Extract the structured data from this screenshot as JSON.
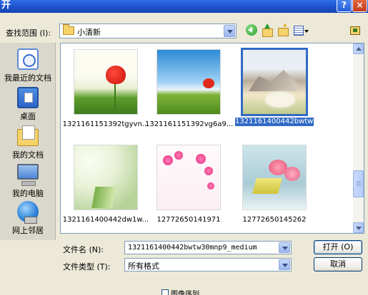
{
  "window": {
    "title": "开",
    "help_label": "?",
    "close_label": "×"
  },
  "toolbar": {
    "look_in_label": "查找范围 (I):",
    "look_in_value": "小清新"
  },
  "places": [
    {
      "label": "我最近的文档",
      "icon": "recent-documents-icon"
    },
    {
      "label": "桌面",
      "icon": "desktop-icon"
    },
    {
      "label": "我的文档",
      "icon": "my-documents-icon"
    },
    {
      "label": "我的电脑",
      "icon": "my-computer-icon"
    },
    {
      "label": "网上邻居",
      "icon": "network-places-icon"
    }
  ],
  "files": [
    {
      "name": "1321161151392tgyvn...",
      "selected": false
    },
    {
      "name": "1321161151392vg6a9...",
      "selected": false
    },
    {
      "name": "1321161400442bwtw30mnp9_medium",
      "selected": true
    },
    {
      "name": "1321161400442dw1w...",
      "selected": false
    },
    {
      "name": "12772650141971",
      "selected": false
    },
    {
      "name": "12772650145262",
      "selected": false
    }
  ],
  "form": {
    "filename_label": "文件名 (N):",
    "filename_value": "1321161400442bwtw30mnp9_medium",
    "filetype_label": "文件类型 (T):",
    "filetype_value": "所有格式",
    "open_label": "打开 (O)",
    "cancel_label": "取消",
    "preview_label": "图像序列"
  },
  "colors": {
    "selection": "#316ac5",
    "titlebar": "#1c4fc9",
    "dialog_bg": "#ece9d8"
  }
}
